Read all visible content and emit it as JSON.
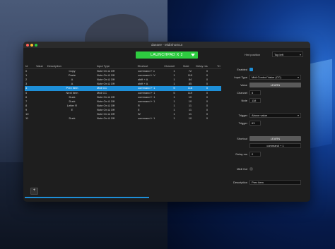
{
  "window": {
    "title": "daeaee - MidiShortcut"
  },
  "topbar": {
    "device_label": "LAUNCHPAD X 2",
    "hint_label": "Hint position",
    "hint_value": "Top left"
  },
  "table": {
    "headers": [
      "Id",
      "Value",
      "Description",
      "Input Type",
      "Shortcut",
      "Channel",
      "Note",
      "Delay ms",
      "Tri"
    ],
    "rows": [
      [
        "0",
        "",
        "Copy",
        "Note On & Off",
        "command + c",
        "1",
        "72",
        "0"
      ],
      [
        "1",
        "",
        "Paste",
        "Note On & Off",
        "command + V",
        "1",
        "119",
        "0"
      ],
      [
        "2",
        "",
        "A",
        "Note On & Off",
        "shift + A",
        "1",
        "84",
        "0"
      ],
      [
        "3",
        "",
        "A",
        "Note On & Off",
        "shift + A",
        "1",
        "85",
        "0"
      ],
      [
        "4",
        "",
        "Prev item",
        "Midi CC",
        "command + 1",
        "5",
        "118",
        "0"
      ],
      [
        "5",
        "",
        "Next item",
        "Midi CC",
        "command + 1",
        "5",
        "119",
        "0"
      ],
      [
        "6",
        "",
        "Duck",
        "Note On & Off",
        "command + 1",
        "1",
        "10",
        "0"
      ],
      [
        "7",
        "",
        "Duck",
        "Note On & Off",
        "command + 1",
        "1",
        "10",
        "0"
      ],
      [
        "8",
        "",
        "Letter R",
        "Note On & Off",
        "R",
        "1",
        "11",
        "0"
      ],
      [
        "9",
        "",
        "E",
        "Note On & Off",
        "E",
        "1",
        "11",
        "0"
      ],
      [
        "10",
        "",
        "",
        "Note On & Off",
        "W",
        "1",
        "11",
        "0"
      ],
      [
        "11",
        "",
        "Duck",
        "Note On & Off",
        "command + 1",
        "1",
        "10",
        "0"
      ]
    ],
    "selected_index": 4
  },
  "add_button": "+",
  "panel": {
    "enabled_label": "Enabled",
    "input_type_label": "Input Type",
    "input_type_value": "Midi Control Value (CC)",
    "value_label": "Value",
    "learn_label": "LEARN",
    "channel_label": "Channel",
    "channel_value": "5",
    "note_label": "Note",
    "note_value": "118",
    "trigger_type_label": "Trigger",
    "trigger_type_value": "Above value",
    "trigger_label": "Trigger",
    "trigger_value": "63",
    "shortcut_label": "Shortcut",
    "shortcut_learn": "LEARN",
    "shortcut_value": "command + 1",
    "delay_label": "Delay ms",
    "delay_value": "0",
    "midi_out_label": "Midi Out",
    "description_label": "Description",
    "description_value": "Prev item"
  }
}
